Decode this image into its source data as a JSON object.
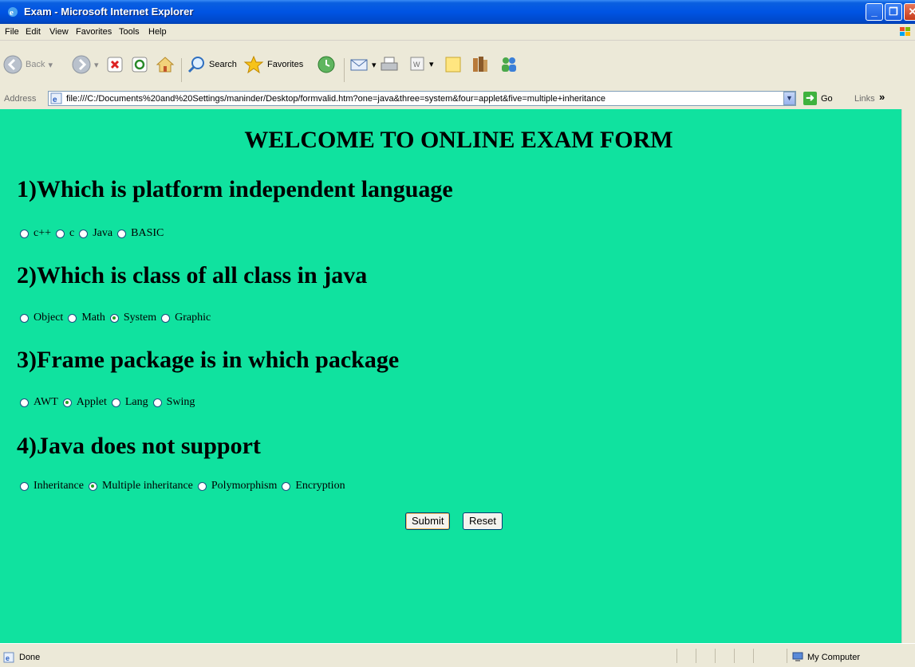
{
  "window": {
    "title": "Exam - Microsoft Internet Explorer",
    "minimize_icon": "minimize-icon",
    "maximize_icon": "restore-icon",
    "close_icon": "close-icon"
  },
  "menu": {
    "items": [
      "File",
      "Edit",
      "View",
      "Favorites",
      "Tools",
      "Help"
    ]
  },
  "toolbar": {
    "back_label": "Back",
    "search_label": "Search",
    "favorites_label": "Favorites"
  },
  "address": {
    "label": "Address",
    "url": "file:///C:/Documents%20and%20Settings/maninder/Desktop/formvalid.htm?one=java&three=system&four=applet&five=multiple+inheritance",
    "go_label": "Go",
    "links_label": "Links",
    "links_chevron": "»"
  },
  "page": {
    "background": "#10e29f",
    "title": "WELCOME TO ONLINE EXAM FORM",
    "questions": [
      {
        "text": "1)Which is platform independent language",
        "options": [
          "c++",
          "c",
          "Java",
          "BASIC"
        ],
        "selected": null
      },
      {
        "text": "2)Which is class of all class in java",
        "options": [
          "Object",
          "Math",
          "System",
          "Graphic"
        ],
        "selected": "System"
      },
      {
        "text": "3)Frame package is in which package",
        "options": [
          "AWT",
          "Applet",
          "Lang",
          "Swing"
        ],
        "selected": "Applet"
      },
      {
        "text": "4)Java does not support",
        "options": [
          "Inheritance",
          "Multiple inheritance",
          "Polymorphism",
          "Encryption"
        ],
        "selected": "Multiple inheritance"
      }
    ],
    "submit_label": "Submit",
    "reset_label": "Reset"
  },
  "status": {
    "text": "Done",
    "zone": "My Computer"
  }
}
